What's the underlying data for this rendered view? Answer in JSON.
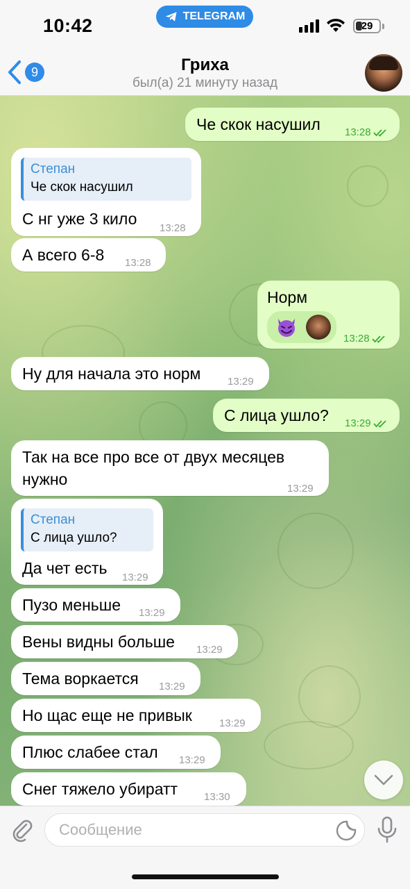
{
  "status_bar": {
    "time": "10:42",
    "app_pill": "TELEGRAM",
    "battery": "29",
    "battery_level": 0.29
  },
  "header": {
    "back_badge": "9",
    "title": "Гриха",
    "subtitle": "был(а) 21 минуту назад"
  },
  "messages": [
    {
      "dir": "out",
      "text": "Че скок насушил",
      "time": "13:28"
    },
    {
      "dir": "in",
      "reply_name": "Степан",
      "reply_text": "Че скок насушил",
      "text": "С нг уже 3 кило",
      "time": "13:28"
    },
    {
      "dir": "in",
      "text": "А всего 6-8",
      "time": "13:28"
    },
    {
      "dir": "out",
      "text": "Норм",
      "time": "13:28",
      "reactions": [
        "smiling-devil-emoji",
        "user-avatar"
      ]
    },
    {
      "dir": "in",
      "text": "Ну для начала это норм",
      "time": "13:29"
    },
    {
      "dir": "out",
      "text": "С лица ушло?",
      "time": "13:29"
    },
    {
      "dir": "in",
      "text_line1": "Так на все про все от двух месяцев",
      "text_line2": "нужно",
      "time": "13:29"
    },
    {
      "dir": "in",
      "reply_name": "Степан",
      "reply_text": "С лица ушло?",
      "text": "Да чет есть",
      "time": "13:29"
    },
    {
      "dir": "in",
      "text": "Пузо меньше",
      "time": "13:29"
    },
    {
      "dir": "in",
      "text": "Вены видны больше",
      "time": "13:29"
    },
    {
      "dir": "in",
      "text": "Тема воркается",
      "time": "13:29"
    },
    {
      "dir": "in",
      "text": "Но щас еще не привык",
      "time": "13:29"
    },
    {
      "dir": "in",
      "text": "Плюс слабее стал",
      "time": "13:29"
    },
    {
      "dir": "in",
      "text": "Снег тяжело убиратт",
      "time": "13:30"
    }
  ],
  "input": {
    "placeholder": "Сообщение"
  },
  "colors": {
    "accent": "#2f8ce8",
    "outgoing_bubble": "#e2fec6",
    "incoming_bubble": "#ffffff",
    "read_check": "#3aaa35"
  }
}
